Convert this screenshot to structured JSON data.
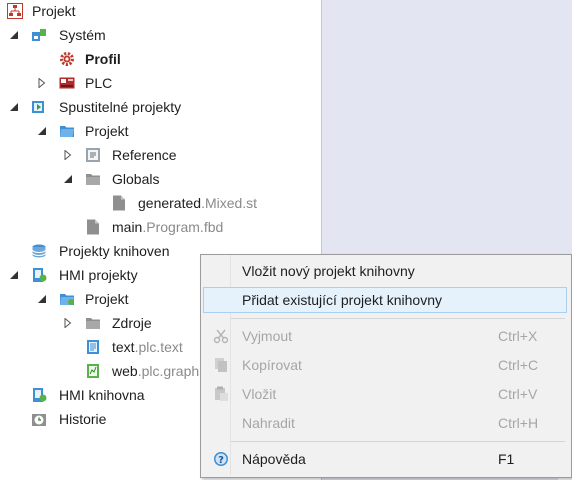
{
  "tree": {
    "root": "Projekt",
    "system": "Systém",
    "profil": "Profil",
    "plc": "PLC",
    "executable": "Spustitelné projekty",
    "exec_project": "Projekt",
    "reference": "Reference",
    "globals": "Globals",
    "generated": {
      "name": "generated",
      "ext": ".Mixed.st"
    },
    "main": {
      "name": "main",
      "ext": ".Program.fbd"
    },
    "libraries": "Projekty knihoven",
    "hmi_projects": "HMI projekty",
    "hmi_project": "Projekt",
    "zdroje": "Zdroje",
    "text": {
      "name": "text",
      "ext": ".plc.text"
    },
    "web": {
      "name": "web",
      "ext": ".plc.graph"
    },
    "hmi_library": "HMI knihovna",
    "history": "Historie"
  },
  "menu": {
    "new_library": "Vložit nový projekt knihovny",
    "add_existing": "Přidat existující projekt knihovny",
    "cut": {
      "label": "Vyjmout",
      "shortcut": "Ctrl+X"
    },
    "copy": {
      "label": "Kopírovat",
      "shortcut": "Ctrl+C"
    },
    "paste": {
      "label": "Vložit",
      "shortcut": "Ctrl+V"
    },
    "replace": {
      "label": "Nahradit",
      "shortcut": "Ctrl+H"
    },
    "help": {
      "label": "Nápověda",
      "shortcut": "F1"
    }
  },
  "colors": {
    "highlight": "#e5f1fb",
    "highlight_border": "#a9d0f0",
    "right_pane": "#e4e5f3"
  }
}
